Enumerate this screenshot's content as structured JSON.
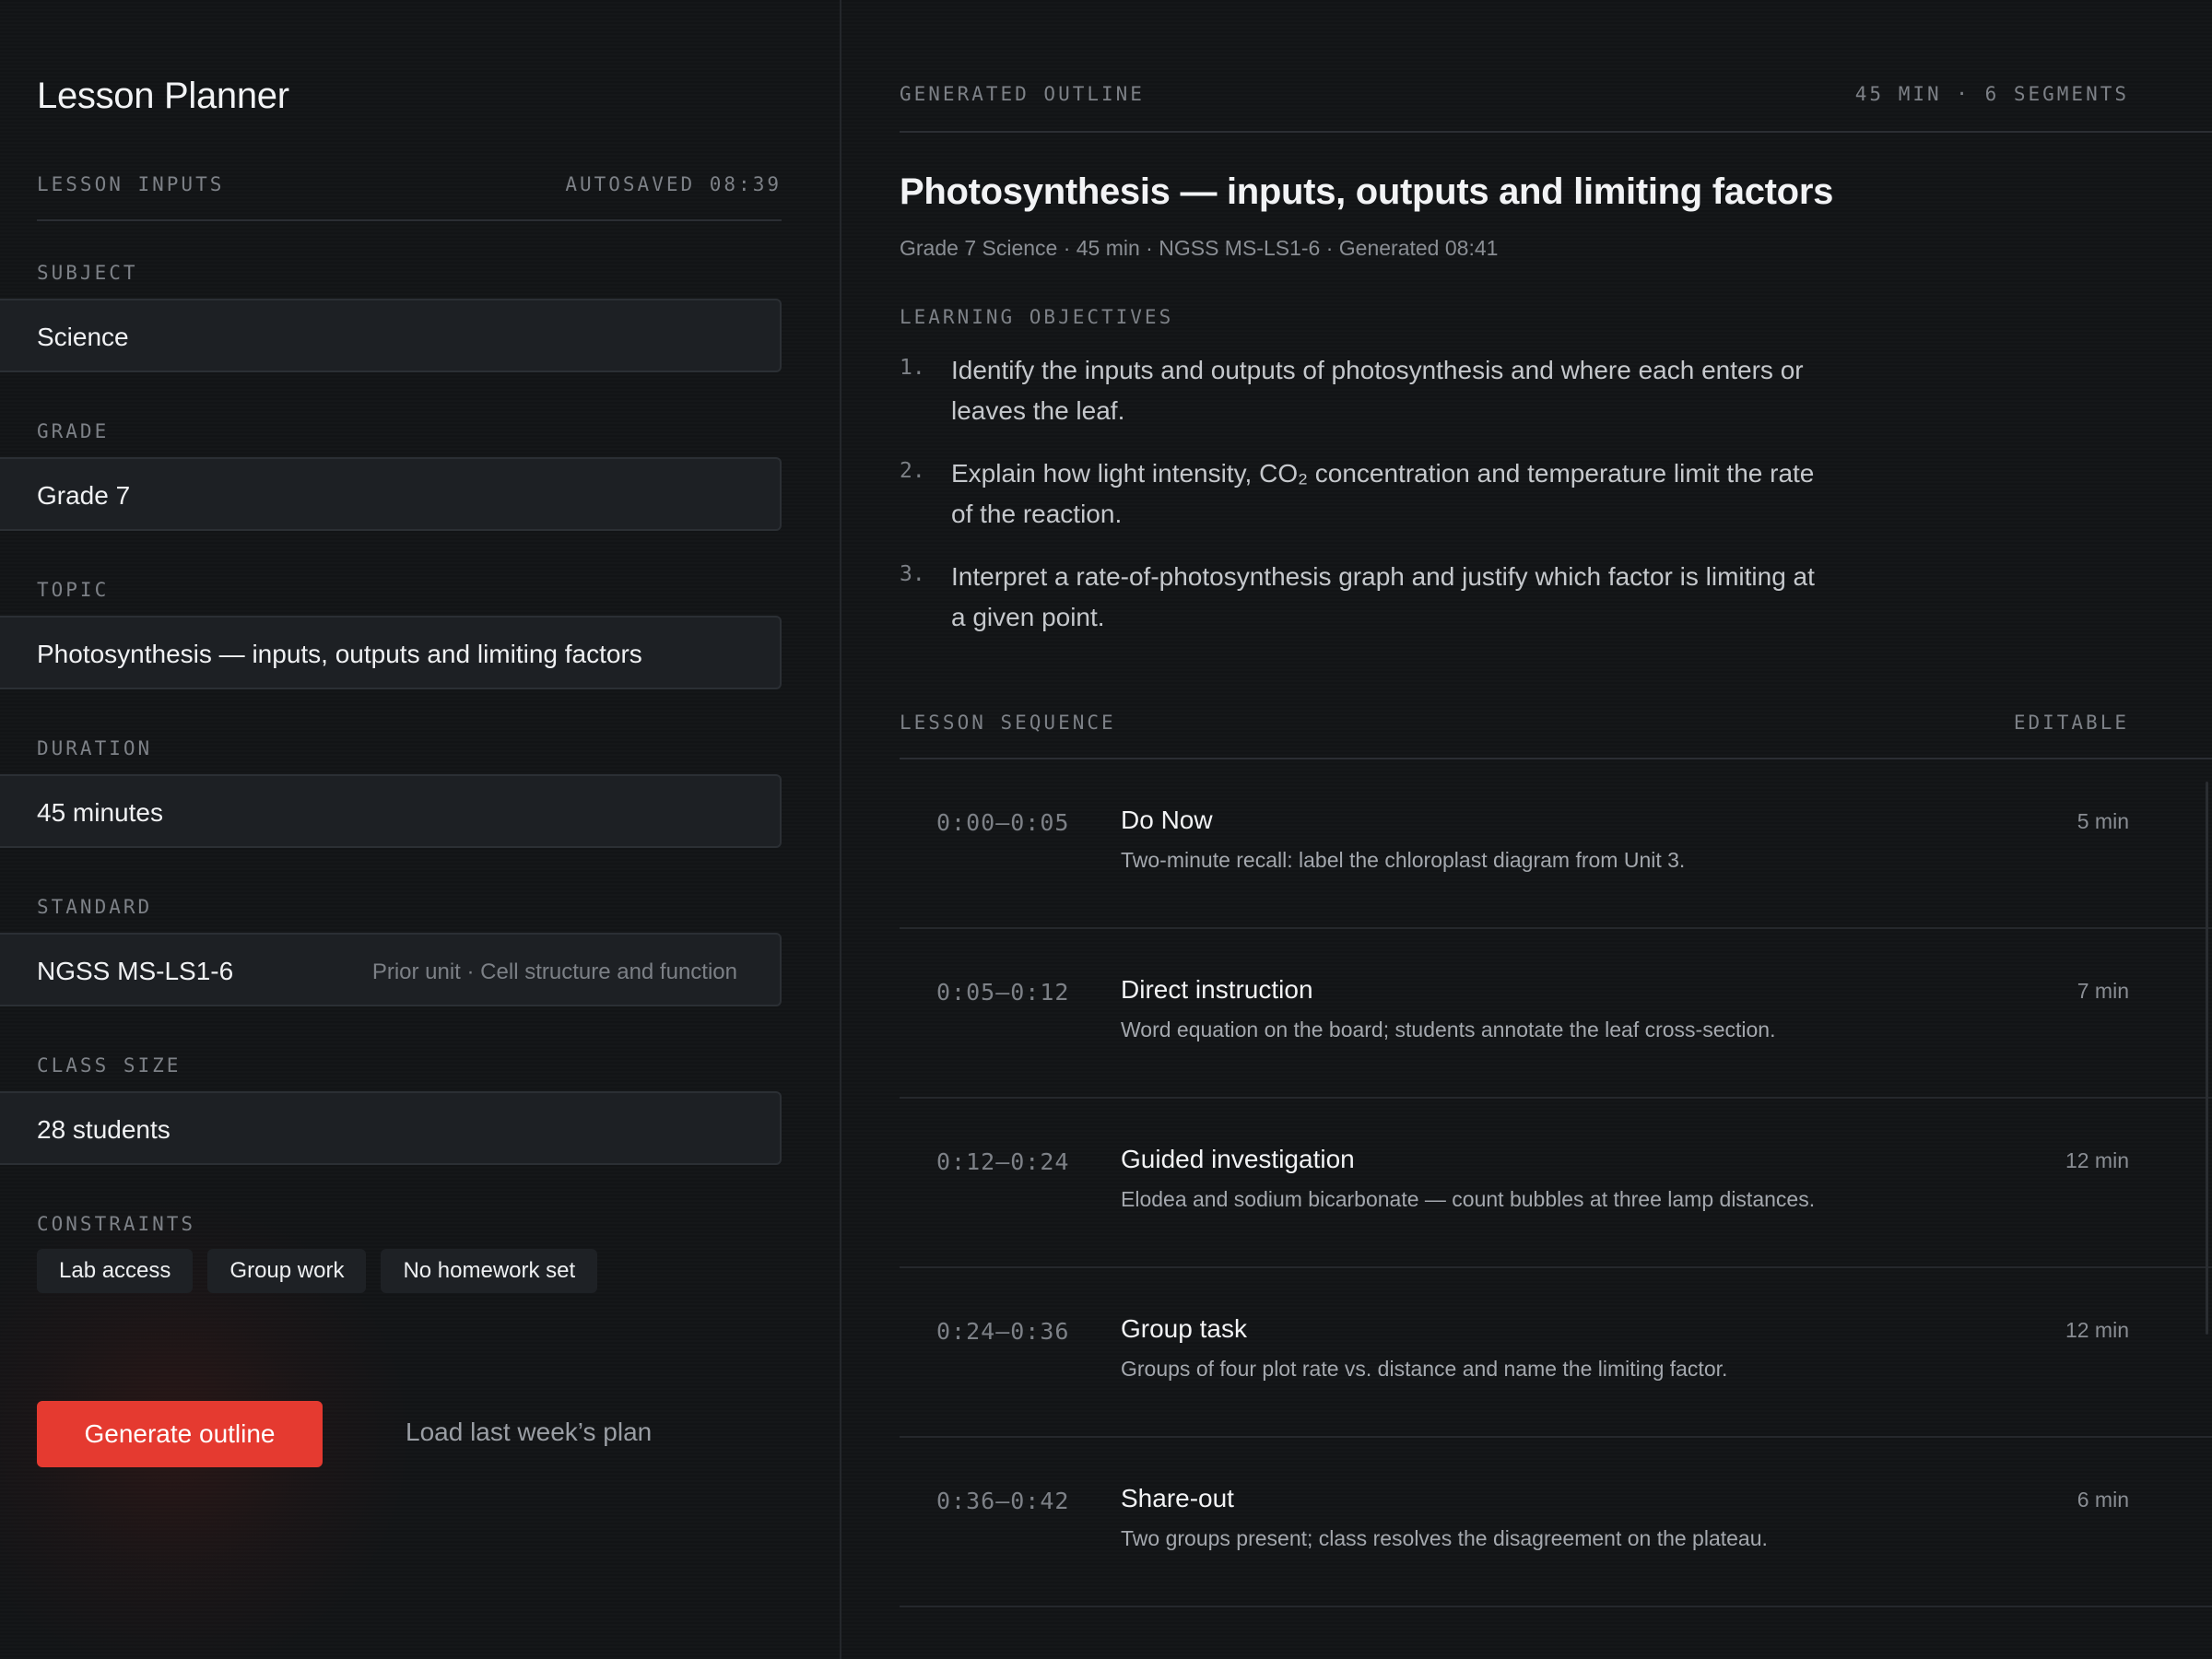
{
  "app": {
    "title": "Lesson Planner"
  },
  "inputs": {
    "section_label": "LESSON INPUTS",
    "autosaved": "AUTOSAVED 08:39",
    "fields": [
      {
        "label": "SUBJECT",
        "value": "Science"
      },
      {
        "label": "GRADE",
        "value": "Grade 7"
      },
      {
        "label": "TOPIC",
        "value": "Photosynthesis — inputs, outputs and limiting factors"
      },
      {
        "label": "DURATION",
        "value": "45 minutes"
      },
      {
        "label": "STANDARD",
        "value": "NGSS MS-LS1-6",
        "hint": "Prior unit · Cell structure and function"
      },
      {
        "label": "CLASS SIZE",
        "value": "28 students"
      }
    ],
    "constraints_label": "CONSTRAINTS",
    "constraints": [
      "Lab access",
      "Group work",
      "No homework set"
    ]
  },
  "actions": {
    "generate": "Generate outline",
    "load_last": "Load last week’s plan"
  },
  "outline": {
    "section_label": "GENERATED OUTLINE",
    "summary": "45 MIN · 6 SEGMENTS",
    "title": "Photosynthesis — inputs, outputs and limiting factors",
    "meta": "Grade 7 Science · 45 min · NGSS MS-LS1-6 · Generated 08:41",
    "objectives_label": "LEARNING OBJECTIVES",
    "objectives": [
      {
        "num": "1.",
        "text": "Identify the inputs and outputs of photosynthesis and where each enters or leaves the leaf."
      },
      {
        "num": "2.",
        "text": "Explain how light intensity, CO₂ concentration and temperature limit the rate of the reaction."
      },
      {
        "num": "3.",
        "text": "Interpret a rate-of-photosynthesis graph and justify which factor is limiting at a given point."
      }
    ],
    "sequence_label": "LESSON SEQUENCE",
    "sequence_editable": "EDITABLE",
    "segments": [
      {
        "time": "0:00–0:05",
        "name": "Do Now",
        "desc": "Two-minute recall: label the chloroplast diagram from Unit 3.",
        "duration": "5 min"
      },
      {
        "time": "0:05–0:12",
        "name": "Direct instruction",
        "desc": "Word equation on the board; students annotate the leaf cross-section.",
        "duration": "7 min"
      },
      {
        "time": "0:12–0:24",
        "name": "Guided investigation",
        "desc": "Elodea and sodium bicarbonate — count bubbles at three lamp distances.",
        "duration": "12 min"
      },
      {
        "time": "0:24–0:36",
        "name": "Group task",
        "desc": "Groups of four plot rate vs. distance and name the limiting factor.",
        "duration": "12 min"
      },
      {
        "time": "0:36–0:42",
        "name": "Share-out",
        "desc": "Two groups present; class resolves the disagreement on the plateau.",
        "duration": "6 min"
      }
    ]
  }
}
